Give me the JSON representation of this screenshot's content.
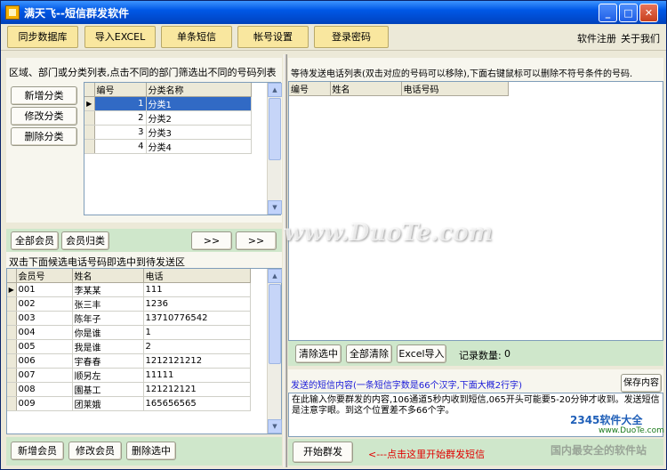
{
  "window": {
    "title": "满天飞--短信群发软件"
  },
  "toolbar": {
    "buttons": [
      "同步数据库",
      "导入EXCEL",
      "单条短信",
      "帐号设置",
      "登录密码"
    ],
    "links": [
      "软件注册",
      "关于我们"
    ]
  },
  "category": {
    "header": "区域、部门或分类列表,点击不同的部门筛选出不同的号码列表",
    "buttons": [
      "新增分类",
      "修改分类",
      "删除分类"
    ],
    "columns": [
      "编号",
      "分类名称"
    ],
    "rows": [
      {
        "id": "1",
        "name": "分类1"
      },
      {
        "id": "2",
        "name": "分类2"
      },
      {
        "id": "3",
        "name": "分类3"
      },
      {
        "id": "4",
        "name": "分类4"
      }
    ]
  },
  "member_bar": {
    "all_members": "全部会员",
    "member_category": "会员归类",
    "move_right": ">>",
    "move_all": ">>"
  },
  "members": {
    "hint": "双击下面候选电话号码即选中到待发送区",
    "columns": [
      "会员号",
      "姓名",
      "电话"
    ],
    "rows": [
      {
        "no": "001",
        "name": "李某某",
        "phone": "111"
      },
      {
        "no": "002",
        "name": "张三丰",
        "phone": "1236"
      },
      {
        "no": "003",
        "name": "陈年子",
        "phone": "13710776542"
      },
      {
        "no": "004",
        "name": "你是谁",
        "phone": "1"
      },
      {
        "no": "005",
        "name": "我是谁",
        "phone": "2"
      },
      {
        "no": "006",
        "name": "宇春春",
        "phone": "1212121212"
      },
      {
        "no": "007",
        "name": "顺另左",
        "phone": "11111"
      },
      {
        "no": "008",
        "name": "園基工",
        "phone": "121212121"
      },
      {
        "no": "009",
        "name": "团莱娥",
        "phone": "165656565"
      }
    ],
    "buttons": [
      "新增会员",
      "修改会员",
      "删除选中"
    ]
  },
  "send_list": {
    "header": "等待发送电话列表(双击对应的号码可以移除),下面右键鼠标可以删除不符号条件的号码.",
    "columns": [
      "编号",
      "姓名",
      "电话号码"
    ],
    "buttons": [
      "清除选中",
      "全部清除",
      "Excel导入"
    ],
    "record_label": "记录数量:",
    "record_count": "0"
  },
  "sms": {
    "label": "发送的短信内容(一条短信字数是66个汉字,下面大概2行字)",
    "save": "保存内容",
    "content": "在此输入你要群发的内容,106通道5秒内收到短信,065开头可能要5-20分钟才收到。发送短信是注意字眼。到这个位置差不多66个字。",
    "send_button": "开始群发",
    "send_hint": "<---点击这里开始群发短信"
  },
  "watermarks": {
    "duote": "www.DuoTe.com",
    "brand": "2345软件大全",
    "brand_url": "www.DuoTe.com",
    "slogan": "国内最安全的软件站"
  },
  "colors": {
    "accent_red": "#e00000",
    "link_blue": "#1a1ad8",
    "tb_button": "#f9e79f"
  }
}
